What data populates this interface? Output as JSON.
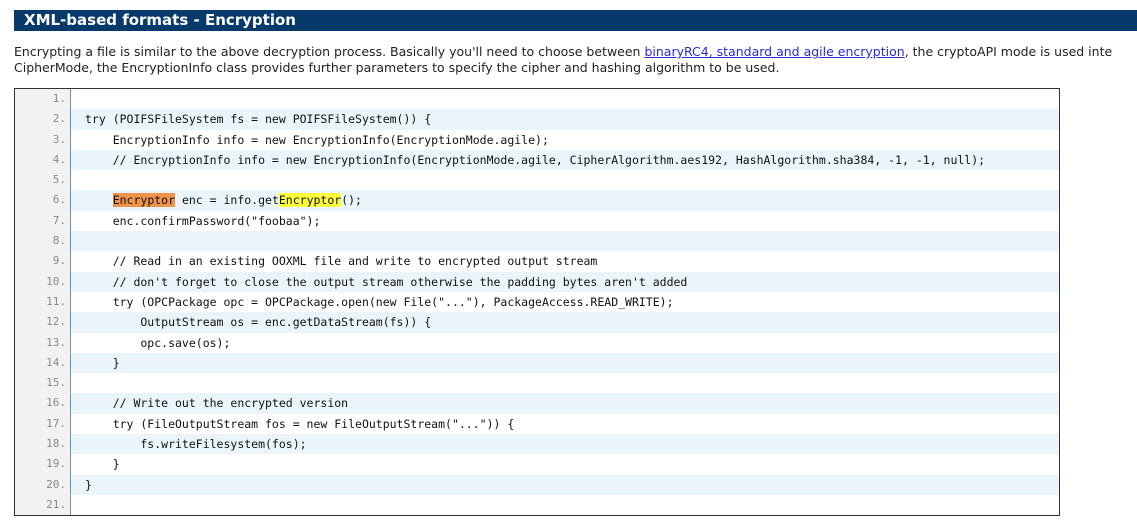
{
  "header": {
    "title": "XML-based formats - Encryption"
  },
  "intro": {
    "line1_before": "Encrypting a file is similar to the above decryption process. Basically you'll need to choose between ",
    "line1_link": "binaryRC4, standard and agile encryption",
    "line1_after": ", the cryptoAPI mode is used inte",
    "line2": "CipherMode, the EncryptionInfo class provides further parameters to specify the cipher and hashing algorithm to be used."
  },
  "code": {
    "lines": [
      {
        "num": "1.",
        "text": ""
      },
      {
        "num": "2.",
        "text": "try (POIFSFileSystem fs = new POIFSFileSystem()) {"
      },
      {
        "num": "3.",
        "text": "    EncryptionInfo info = new EncryptionInfo(EncryptionMode.agile);"
      },
      {
        "num": "4.",
        "text": "    // EncryptionInfo info = new EncryptionInfo(EncryptionMode.agile, CipherAlgorithm.aes192, HashAlgorithm.sha384, -1, -1, null);"
      },
      {
        "num": "5.",
        "text": ""
      },
      {
        "num": "6.",
        "indent": "    ",
        "hl1": "Encryptor",
        "mid": " enc = info.get",
        "hl2": "Encryptor",
        "tail": "();"
      },
      {
        "num": "7.",
        "text": "    enc.confirmPassword(\"foobaa\");"
      },
      {
        "num": "8.",
        "text": ""
      },
      {
        "num": "9.",
        "text": "    // Read in an existing OOXML file and write to encrypted output stream"
      },
      {
        "num": "10.",
        "text": "    // don't forget to close the output stream otherwise the padding bytes aren't added"
      },
      {
        "num": "11.",
        "text": "    try (OPCPackage opc = OPCPackage.open(new File(\"...\"), PackageAccess.READ_WRITE);"
      },
      {
        "num": "12.",
        "text": "        OutputStream os = enc.getDataStream(fs)) {"
      },
      {
        "num": "13.",
        "text": "        opc.save(os);"
      },
      {
        "num": "14.",
        "text": "    }"
      },
      {
        "num": "15.",
        "text": ""
      },
      {
        "num": "16.",
        "text": "    // Write out the encrypted version"
      },
      {
        "num": "17.",
        "text": "    try (FileOutputStream fos = new FileOutputStream(\"...\")) {"
      },
      {
        "num": "18.",
        "text": "        fs.writeFilesystem(fos);"
      },
      {
        "num": "19.",
        "text": "    }"
      },
      {
        "num": "20.",
        "text": "}"
      },
      {
        "num": "21.",
        "text": ""
      }
    ]
  },
  "colors": {
    "header_bg": "#073a6b",
    "link": "#2a2ad8",
    "row_shade": "#e9f4fb",
    "highlight_orange": "#f0944a",
    "highlight_yellow": "#ffff3a"
  }
}
